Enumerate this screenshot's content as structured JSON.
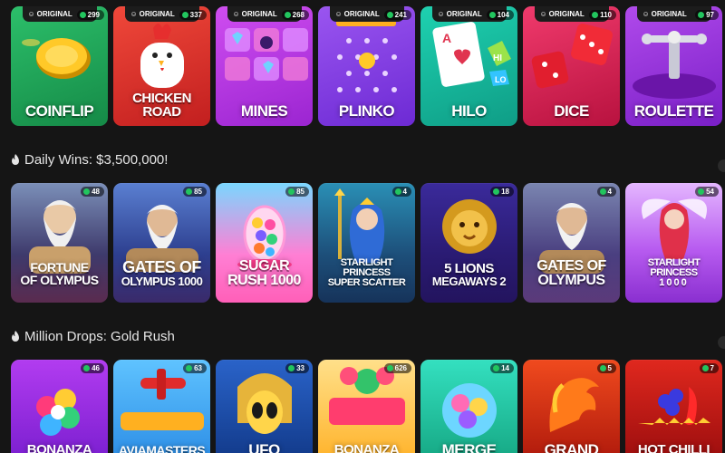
{
  "originals": {
    "badge_label": "ORIGINAL",
    "games": [
      {
        "title": "COINFLIP",
        "players": "299",
        "bg": "#1f9d55"
      },
      {
        "title": "CHICKEN ROAD",
        "players": "337",
        "bg": "#e23a2c"
      },
      {
        "title": "MINES",
        "players": "268",
        "bg": "#b734e8"
      },
      {
        "title": "PLINKO",
        "players": "241",
        "bg": "#8b3fe6"
      },
      {
        "title": "HILO",
        "players": "104",
        "bg": "#14b89a"
      },
      {
        "title": "DICE",
        "players": "110",
        "bg": "#e1245a"
      },
      {
        "title": "ROULETTE",
        "players": "97",
        "bg": "#9b2ed6"
      }
    ]
  },
  "daily_wins": {
    "title": "Daily Wins: $3,500,000!",
    "games": [
      {
        "title_line1": "FORTUNE",
        "title_line2": "OF OLYMPUS",
        "players": "48"
      },
      {
        "title_line1": "GATES OF",
        "title_line2": "OLYMPUS 1000",
        "players": "85"
      },
      {
        "title_line1": "SUGAR",
        "title_line2": "RUSH 1000",
        "players": "85"
      },
      {
        "title_line1": "STARLIGHT PRINCESS",
        "title_line2": "SUPER SCATTER",
        "players": "4"
      },
      {
        "title_line1": "5 LIONS",
        "title_line2": "MEGAWAYS 2",
        "players": "18"
      },
      {
        "title_line1": "GATES OF",
        "title_line2": "OLYMPUS",
        "players": "4"
      },
      {
        "title_line1": "STARLIGHT PRINCESS",
        "title_line2": "1000",
        "players": "54"
      }
    ]
  },
  "million_drops": {
    "title": "Million Drops: Gold Rush",
    "games": [
      {
        "title": "BONANZA",
        "players": "46"
      },
      {
        "title": "AVIAMASTERS",
        "players": "63"
      },
      {
        "title": "UFO",
        "players": "33"
      },
      {
        "title": "BONANZA",
        "players": "626"
      },
      {
        "title": "MERGE",
        "players": "14"
      },
      {
        "title": "GRAND",
        "players": "5"
      },
      {
        "title": "HOT CHILLI",
        "players": "7"
      }
    ]
  }
}
